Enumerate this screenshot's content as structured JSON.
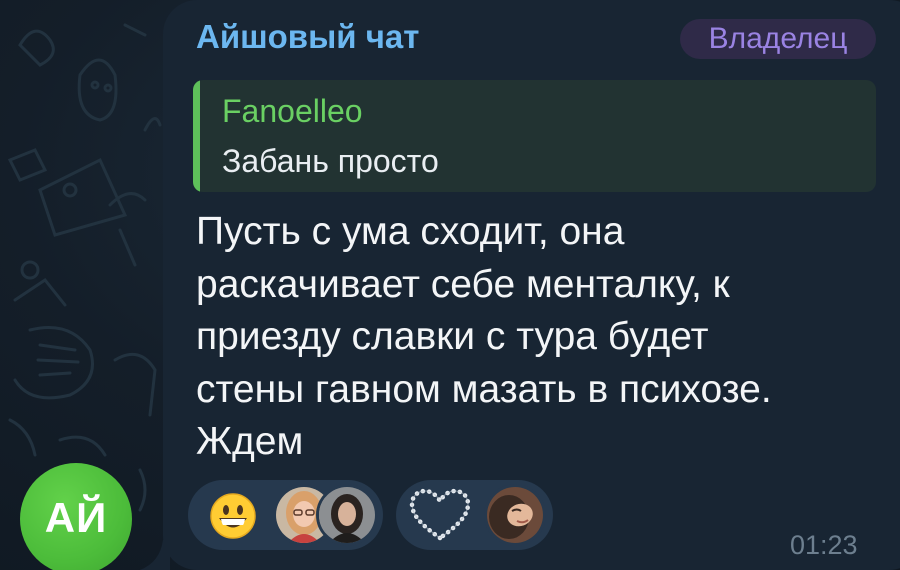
{
  "avatar": {
    "initials": "АЙ",
    "color": "#4cbc3a"
  },
  "message": {
    "sender_name": "Айшовый чат",
    "sender_color": "#6cb7f0",
    "badge": "Владелец",
    "reply": {
      "name": "Fanoelleo",
      "text": "Забань просто"
    },
    "lines": [
      "Пусть с ума сходит, она",
      "раскачивает себе менталку, к",
      "приезду славки с тура будет",
      "стены гавном мазать в психозе.",
      "Ждем"
    ],
    "time": "01:23"
  },
  "reactions": [
    {
      "emoji": "grinning-face-icon",
      "avatars": [
        "reactor-avatar-1",
        "reactor-avatar-2"
      ]
    },
    {
      "emoji": "pearl-heart-icon",
      "avatars": [
        "reactor-avatar-3"
      ]
    }
  ],
  "colors": {
    "bubble": "#182533",
    "background": "#0e1621",
    "badge_text": "#9a83e3",
    "reply_accent": "#5ec05a",
    "reaction_bg": "#26394e"
  }
}
